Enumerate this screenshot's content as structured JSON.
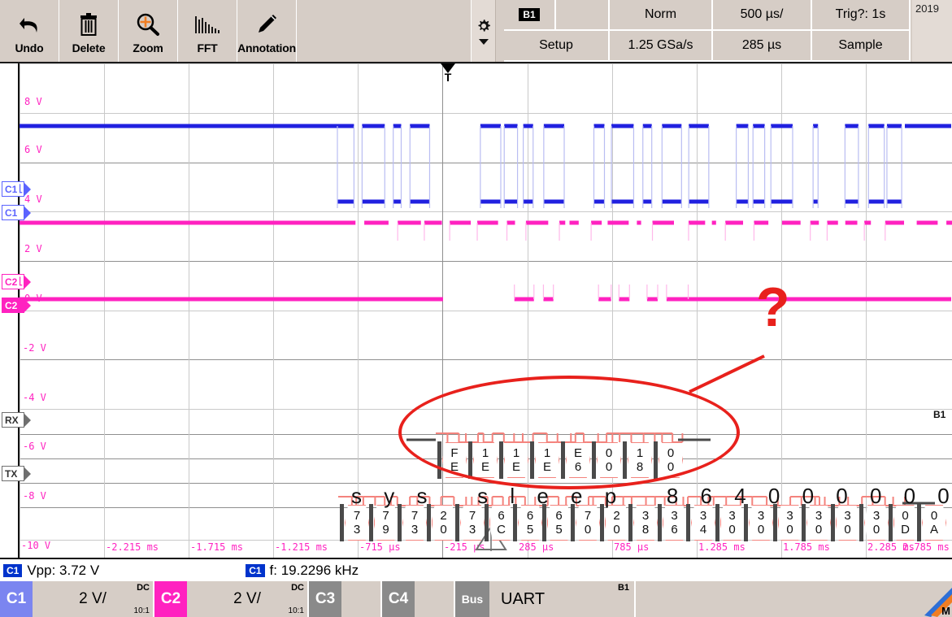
{
  "toolbar": {
    "buttons": [
      {
        "label": "Undo",
        "icon": "undo-arrow-icon"
      },
      {
        "label": "Delete",
        "icon": "trash-icon"
      },
      {
        "label": "Zoom",
        "icon": "magnifier-plus-icon"
      },
      {
        "label": "FFT",
        "icon": "fft-spectrum-icon"
      },
      {
        "label": "Annotation",
        "icon": "pencil-icon"
      }
    ],
    "gear_icon": "gear-icon"
  },
  "status": {
    "bus_chip": "B1",
    "acq_mode": "Norm",
    "timebase": "500 µs/",
    "trigger": "Trig?: 1s",
    "setup": "Setup",
    "sample_rate": "1.25 GSa/s",
    "delay": "285 µs",
    "acquisition": "Sample",
    "date": "2019"
  },
  "graph": {
    "voltage_labels": [
      "8 V",
      "6 V",
      "4 V",
      "2 V",
      "0 V",
      "-2 V",
      "-4 V",
      "-6 V",
      "-8 V",
      "-10 V"
    ],
    "time_labels": [
      "-2.215 ms",
      "-1.715 ms",
      "-1.215 ms",
      "-715 µs",
      "-215 µs",
      "285 µs",
      "785 µs",
      "1.285 ms",
      "1.785 ms",
      "2.285 ms",
      "2.785 ms"
    ],
    "markers": [
      {
        "name": "C1 trigger level",
        "label": "C1",
        "type": "trigger"
      },
      {
        "name": "C1 ground",
        "label": "C1",
        "type": "ground"
      },
      {
        "name": "C2 trigger level",
        "label": "C2",
        "type": "trigger"
      },
      {
        "name": "C2 ground",
        "label": "C2",
        "type": "ground"
      },
      {
        "name": "RX bus",
        "label": "RX",
        "type": "bus"
      },
      {
        "name": "TX bus",
        "label": "TX",
        "type": "bus"
      }
    ],
    "trigger_marker": "T",
    "bus_label_right": "B1",
    "colors": {
      "c1": "#2020e0",
      "c2": "#ff22c0",
      "bus_decode": "#f4837d",
      "annotation": "#e8211c"
    }
  },
  "bus_decode": {
    "rx": {
      "label": "RX",
      "bytes": [
        "FE",
        "1E",
        "1E",
        "1E",
        "E6",
        "00",
        "18",
        "00"
      ]
    },
    "tx": {
      "label": "TX",
      "bytes": [
        "73",
        "79",
        "73",
        "20",
        "73",
        "6C",
        "65",
        "65",
        "70",
        "20",
        "38",
        "36",
        "34",
        "30",
        "30",
        "30",
        "30",
        "30",
        "30",
        "0D",
        "0A"
      ],
      "ascii": "s y s   s l e e p   8 6 4 0 0 0 0 0 0"
    }
  },
  "annotation": {
    "question_mark": "?"
  },
  "measurements": [
    {
      "chip": "C1",
      "text": "Vpp: 3.72 V"
    },
    {
      "chip": "C1",
      "text": "f: 19.2296 kHz"
    }
  ],
  "channels": [
    {
      "id": "C1",
      "value": "2 V/",
      "coupling": "DC",
      "attenuation": "10:1",
      "color": "#7b85f0",
      "active": true
    },
    {
      "id": "C2",
      "value": "2 V/",
      "coupling": "DC",
      "attenuation": "10:1",
      "color": "#ff22c0",
      "active": true
    },
    {
      "id": "C3",
      "value": "",
      "coupling": "",
      "attenuation": "",
      "color": "#8a8a8a",
      "active": false
    },
    {
      "id": "C4",
      "value": "",
      "coupling": "",
      "attenuation": "",
      "color": "#8a8a8a",
      "active": false
    }
  ],
  "bus": {
    "id": "Bus",
    "name": "UART",
    "badge": "B1"
  },
  "brand": {
    "mark": "M"
  }
}
